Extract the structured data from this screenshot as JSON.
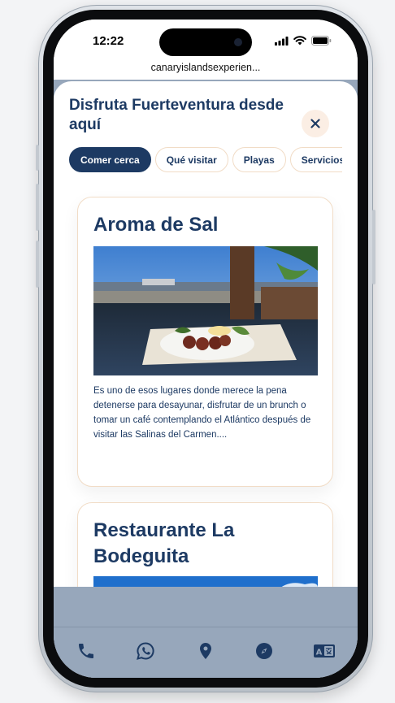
{
  "status_bar": {
    "time": "12:22"
  },
  "browser": {
    "url": "canaryislandsexperien..."
  },
  "sheet": {
    "title": "Disfruta Fuerteventura desde aquí",
    "close_label": "×",
    "chips": [
      {
        "label": "Comer cerca",
        "active": true
      },
      {
        "label": "Qué visitar",
        "active": false
      },
      {
        "label": "Playas",
        "active": false
      },
      {
        "label": "Servicios",
        "active": false
      }
    ]
  },
  "cards": [
    {
      "title": "Aroma de Sal",
      "image": "restaurant-terrace-ocean-view",
      "description": "Es uno de esos lugares donde merece la pena detenerse para desayunar, disfrutar de un brunch o tomar un café contemplando el Atlántico después de visitar las Salinas del Carmen...."
    },
    {
      "title": "Restaurante La Bodeguita",
      "image": "blue-sky"
    }
  ],
  "bottom_nav": [
    {
      "icon": "phone-icon"
    },
    {
      "icon": "whatsapp-icon"
    },
    {
      "icon": "location-pin-icon"
    },
    {
      "icon": "compass-icon"
    },
    {
      "icon": "translate-icon"
    }
  ],
  "colors": {
    "primary": "#1d3a63",
    "chip_border": "#f1dcc6",
    "close_bg": "#fbeee4",
    "backdrop": "#97a7bb"
  }
}
